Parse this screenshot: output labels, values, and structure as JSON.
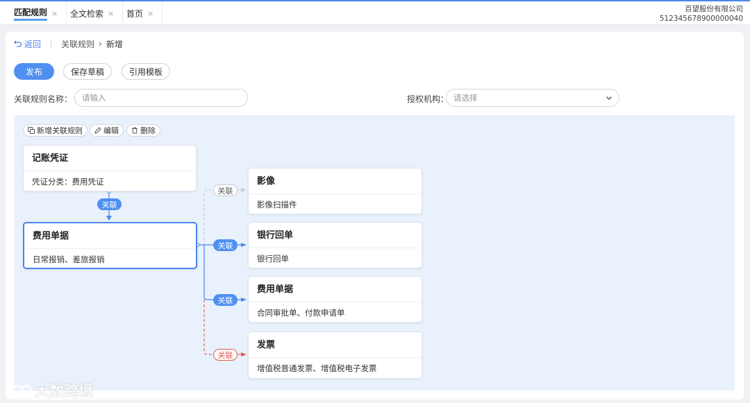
{
  "tabs": [
    {
      "label": "匹配规则",
      "close": "×",
      "active": true
    },
    {
      "label": "全文检索",
      "close": "×",
      "active": false
    },
    {
      "label": "首页",
      "close": "×",
      "active": false
    }
  ],
  "company": {
    "name": "百望股份有限公司",
    "code": "512345678900000040"
  },
  "breadcrumb": {
    "back": "返回",
    "parent": "关联规则",
    "arrow": "›",
    "current": "新增"
  },
  "actions": {
    "publish": "发布",
    "save_draft": "保存草稿",
    "use_template": "引用模板"
  },
  "form": {
    "rule_name_label": "关联规则名称：",
    "required_mark": "*",
    "rule_name_placeholder": "请输入",
    "org_label": "授权机构：",
    "org_placeholder": "请选择"
  },
  "toolbar": {
    "add": "新增关联规则",
    "edit": "编辑",
    "delete": "删除"
  },
  "link_label": "关联",
  "nodes": {
    "voucher": {
      "title": "记账凭证",
      "desc": "凭证分类：费用凭证"
    },
    "expense": {
      "title": "费用单据",
      "desc": "日常报销、差旅报销"
    },
    "image": {
      "title": "影像",
      "desc": "影像扫描件"
    },
    "bank": {
      "title": "银行回单",
      "desc": "银行回单"
    },
    "expense2": {
      "title": "费用单据",
      "desc": "合同审批单、付款申请单"
    },
    "invoice": {
      "title": "发票",
      "desc": "增值税普通发票、增值税电子发票"
    }
  },
  "watermark": "大数跨境",
  "colors": {
    "accent": "#4f8ff0",
    "canvas": "#e8f1fc",
    "danger": "#e2584a"
  }
}
